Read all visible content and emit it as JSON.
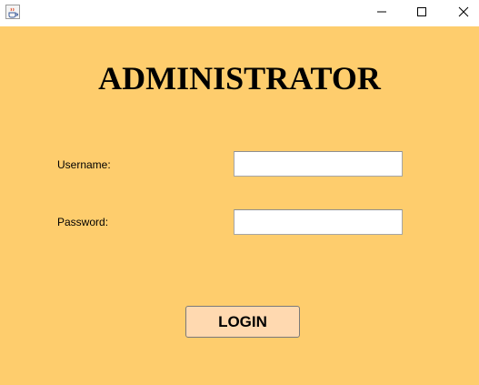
{
  "window": {
    "icons": {
      "app": "java-coffee-cup-icon",
      "minimize": "minimize-icon",
      "maximize": "maximize-icon",
      "close": "close-icon"
    }
  },
  "form": {
    "title": "ADMINISTRATOR",
    "username_label": "Username:",
    "username_value": "",
    "password_label": "Password:",
    "password_value": "",
    "login_label": "LOGIN"
  },
  "colors": {
    "background": "#fecd6d",
    "login_button": "#ffd9b0"
  }
}
